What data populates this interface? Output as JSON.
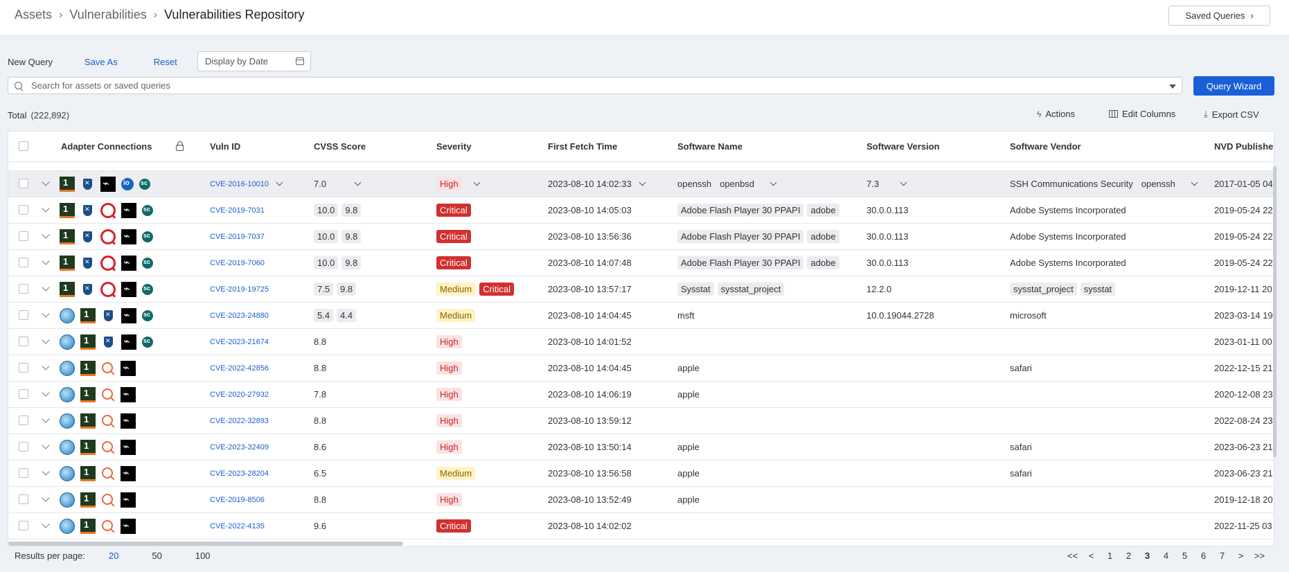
{
  "breadcrumb": [
    "Assets",
    "Vulnerabilities",
    "Vulnerabilities Repository"
  ],
  "saved_queries_label": "Saved Queries",
  "toolbar": {
    "new_query": "New Query",
    "save_as": "Save As",
    "reset": "Reset",
    "date_placeholder": "Display by Date"
  },
  "search": {
    "placeholder": "Search for assets or saved queries",
    "value": ""
  },
  "query_wizard_label": "Query Wizard",
  "total": {
    "label": "Total",
    "count": "(222,892)"
  },
  "table_actions": {
    "actions": "Actions",
    "edit_columns": "Edit Columns",
    "export_csv": "Export CSV"
  },
  "columns": [
    "Adapter Connections",
    "Vuln ID",
    "CVSS Score",
    "Severity",
    "First Fetch Time",
    "Software Name",
    "Software Version",
    "Software Vendor",
    "NVD Publishe"
  ],
  "rows": [
    {
      "adapters": [
        "hdr-icon",
        "shield-icon",
        "black-adapter-icon",
        "io-icon",
        "sc-icon"
      ],
      "vuln_id": "CVE-2016-10010",
      "cvss": [
        "7.0"
      ],
      "severity": [
        "High"
      ],
      "fetch": "2023-08-10 14:02:33",
      "software": [
        "openssh",
        "openbsd"
      ],
      "version": "7.3",
      "vendor": [
        "SSH Communications Security",
        "openssh"
      ],
      "nvd": "2017-01-05 04",
      "highlight": true,
      "plain": true,
      "dropdowns": true
    },
    {
      "adapters": [
        "hdr-icon",
        "shield-icon",
        "qualys-icon",
        "black-adapter-icon",
        "sc-icon"
      ],
      "vuln_id": "CVE-2019-7031",
      "cvss": [
        "10.0",
        "9.8"
      ],
      "severity": [
        "Critical"
      ],
      "fetch": "2023-08-10 14:05:03",
      "software": [
        "Adobe Flash Player 30 PPAPI",
        "adobe"
      ],
      "version": "30.0.0.113",
      "vendor": [
        "Adobe Systems Incorporated"
      ],
      "nvd": "2019-05-24 22"
    },
    {
      "adapters": [
        "hdr-icon",
        "shield-icon",
        "qualys-icon",
        "black-adapter-icon",
        "sc-icon"
      ],
      "vuln_id": "CVE-2019-7037",
      "cvss": [
        "10.0",
        "9.8"
      ],
      "severity": [
        "Critical"
      ],
      "fetch": "2023-08-10 13:56:36",
      "software": [
        "Adobe Flash Player 30 PPAPI",
        "adobe"
      ],
      "version": "30.0.0.113",
      "vendor": [
        "Adobe Systems Incorporated"
      ],
      "nvd": "2019-05-24 22"
    },
    {
      "adapters": [
        "hdr-icon",
        "shield-icon",
        "qualys-icon",
        "black-adapter-icon",
        "sc-icon"
      ],
      "vuln_id": "CVE-2019-7060",
      "cvss": [
        "10.0",
        "9.8"
      ],
      "severity": [
        "Critical"
      ],
      "fetch": "2023-08-10 14:07:48",
      "software": [
        "Adobe Flash Player 30 PPAPI",
        "adobe"
      ],
      "version": "30.0.0.113",
      "vendor": [
        "Adobe Systems Incorporated"
      ],
      "nvd": "2019-05-24 22"
    },
    {
      "adapters": [
        "hdr-icon",
        "shield-icon",
        "qualys-icon",
        "black-adapter-icon",
        "sc-icon"
      ],
      "vuln_id": "CVE-2019-19725",
      "cvss": [
        "7.5",
        "9.8"
      ],
      "severity": [
        "Medium",
        "Critical"
      ],
      "fetch": "2023-08-10 13:57:17",
      "software": [
        "Sysstat",
        "sysstat_project"
      ],
      "version": "12.2.0",
      "vendor": [
        "sysstat_project",
        "sysstat"
      ],
      "nvd": "2019-12-11 20"
    },
    {
      "adapters": [
        "globe-icon",
        "hdr-icon",
        "shield-icon",
        "black-adapter-icon",
        "sc-icon"
      ],
      "vuln_id": "CVE-2023-24880",
      "cvss": [
        "5.4",
        "4.4"
      ],
      "severity": [
        "Medium"
      ],
      "fetch": "2023-08-10 14:04:45",
      "software": [
        "msft"
      ],
      "version": "10.0.19044.2728",
      "vendor": [
        "microsoft"
      ],
      "nvd": "2023-03-14 19",
      "plain": true
    },
    {
      "adapters": [
        "globe-icon",
        "hdr-icon",
        "shield-icon",
        "black-adapter-icon",
        "sc-icon"
      ],
      "vuln_id": "CVE-2023-21674",
      "cvss": [
        "8.8"
      ],
      "severity": [
        "High"
      ],
      "fetch": "2023-08-10 14:01:52",
      "software": [],
      "version": "",
      "vendor": [],
      "nvd": "2023-01-11 00",
      "plain": true
    },
    {
      "adapters": [
        "globe-icon",
        "hdr-icon",
        "search-adapter-icon",
        "black-adapter-icon"
      ],
      "vuln_id": "CVE-2022-42856",
      "cvss": [
        "8.8"
      ],
      "severity": [
        "High"
      ],
      "fetch": "2023-08-10 14:04:45",
      "software": [
        "apple"
      ],
      "version": "",
      "vendor": [
        "safari"
      ],
      "nvd": "2022-12-15 21",
      "plain": true
    },
    {
      "adapters": [
        "globe-icon",
        "hdr-icon",
        "search-adapter-icon",
        "black-adapter-icon"
      ],
      "vuln_id": "CVE-2020-27932",
      "cvss": [
        "7.8"
      ],
      "severity": [
        "High"
      ],
      "fetch": "2023-08-10 14:06:19",
      "software": [
        "apple"
      ],
      "version": "",
      "vendor": [],
      "nvd": "2020-12-08 23",
      "plain": true
    },
    {
      "adapters": [
        "globe-icon",
        "hdr-icon",
        "search-adapter-icon",
        "black-adapter-icon"
      ],
      "vuln_id": "CVE-2022-32893",
      "cvss": [
        "8.8"
      ],
      "severity": [
        "High"
      ],
      "fetch": "2023-08-10 13:59:12",
      "software": [],
      "version": "",
      "vendor": [],
      "nvd": "2022-08-24 23",
      "plain": true
    },
    {
      "adapters": [
        "globe-icon",
        "hdr-icon",
        "search-adapter-icon",
        "black-adapter-icon"
      ],
      "vuln_id": "CVE-2023-32409",
      "cvss": [
        "8.6"
      ],
      "severity": [
        "High"
      ],
      "fetch": "2023-08-10 13:50:14",
      "software": [
        "apple"
      ],
      "version": "",
      "vendor": [
        "safari"
      ],
      "nvd": "2023-06-23 21",
      "plain": true
    },
    {
      "adapters": [
        "globe-icon",
        "hdr-icon",
        "search-adapter-icon",
        "black-adapter-icon"
      ],
      "vuln_id": "CVE-2023-28204",
      "cvss": [
        "6.5"
      ],
      "severity": [
        "Medium"
      ],
      "fetch": "2023-08-10 13:56:58",
      "software": [
        "apple"
      ],
      "version": "",
      "vendor": [
        "safari"
      ],
      "nvd": "2023-06-23 21",
      "plain": true
    },
    {
      "adapters": [
        "globe-icon",
        "hdr-icon",
        "search-adapter-icon",
        "black-adapter-icon"
      ],
      "vuln_id": "CVE-2019-8506",
      "cvss": [
        "8.8"
      ],
      "severity": [
        "High"
      ],
      "fetch": "2023-08-10 13:52:49",
      "software": [
        "apple"
      ],
      "version": "",
      "vendor": [],
      "nvd": "2019-12-18 20",
      "plain": true
    },
    {
      "adapters": [
        "globe-icon",
        "hdr-icon",
        "search-adapter-icon",
        "black-adapter-icon"
      ],
      "vuln_id": "CVE-2022-4135",
      "cvss": [
        "9.6"
      ],
      "severity": [
        "Critical"
      ],
      "fetch": "2023-08-10 14:02:02",
      "software": [],
      "version": "",
      "vendor": [],
      "nvd": "2022-11-25 03",
      "plain": true
    }
  ],
  "footer": {
    "results_per_page_label": "Results per page:",
    "page_sizes": [
      "20",
      "50",
      "100"
    ],
    "active_page_size": "20"
  },
  "pager": [
    "<<",
    "<",
    "1",
    "2",
    "3",
    "4",
    "5",
    "6",
    "7",
    ">",
    ">>"
  ],
  "active_page": "3"
}
